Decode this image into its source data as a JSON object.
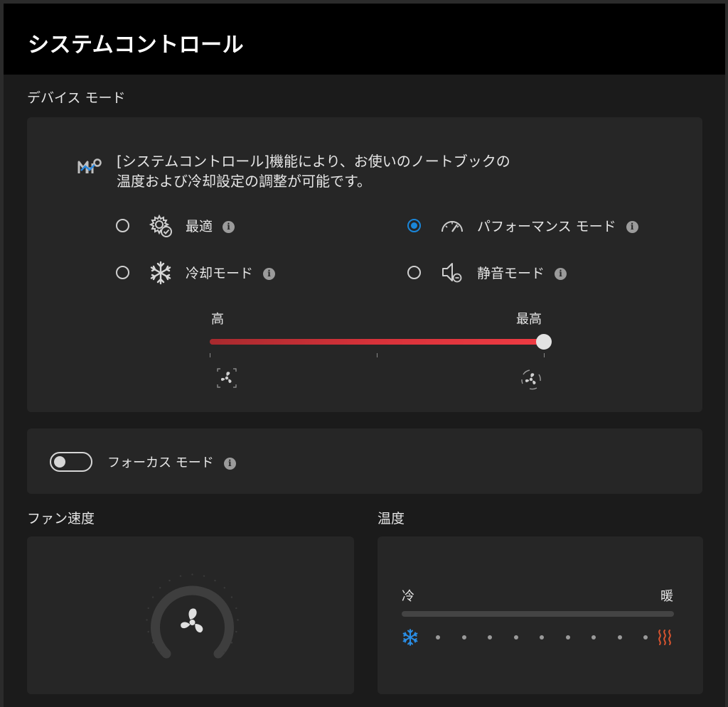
{
  "app": {
    "title": "システムコントロール"
  },
  "device_mode": {
    "section_label": "デバイス モード",
    "description_line1": "[システムコントロール]機能により、お使いのノートブックの",
    "description_line2": "温度および冷却設定の調整が可能です。",
    "modes": [
      {
        "id": "optimal",
        "label": "最適",
        "icon": "gear-check-icon",
        "selected": false
      },
      {
        "id": "performance",
        "label": "パフォーマンス モード",
        "icon": "speedometer-icon",
        "selected": true
      },
      {
        "id": "cooling",
        "label": "冷却モード",
        "icon": "snowflake-icon",
        "selected": false
      },
      {
        "id": "quiet",
        "label": "静音モード",
        "icon": "speaker-quiet-icon",
        "selected": false
      }
    ],
    "performance_slider": {
      "min_label": "高",
      "max_label": "最高",
      "steps": 3,
      "value_step": 3
    }
  },
  "focus_mode": {
    "label": "フォーカス モード",
    "enabled": false
  },
  "fan_speed": {
    "section_label": "ファン速度",
    "icon": "fan-icon"
  },
  "temperature": {
    "section_label": "温度",
    "cold_label": "冷",
    "warm_label": "暖",
    "dot_count": 9,
    "cold_icon": "snowflake-icon",
    "warm_icon": "heat-waves-icon"
  },
  "colors": {
    "accent_blue": "#1a86d9",
    "slider_red": "#e53a41",
    "heat_orange": "#d8542f",
    "card_bg": "#262626",
    "window_bg": "#1b1b1b",
    "titlebar_bg": "#000000"
  }
}
